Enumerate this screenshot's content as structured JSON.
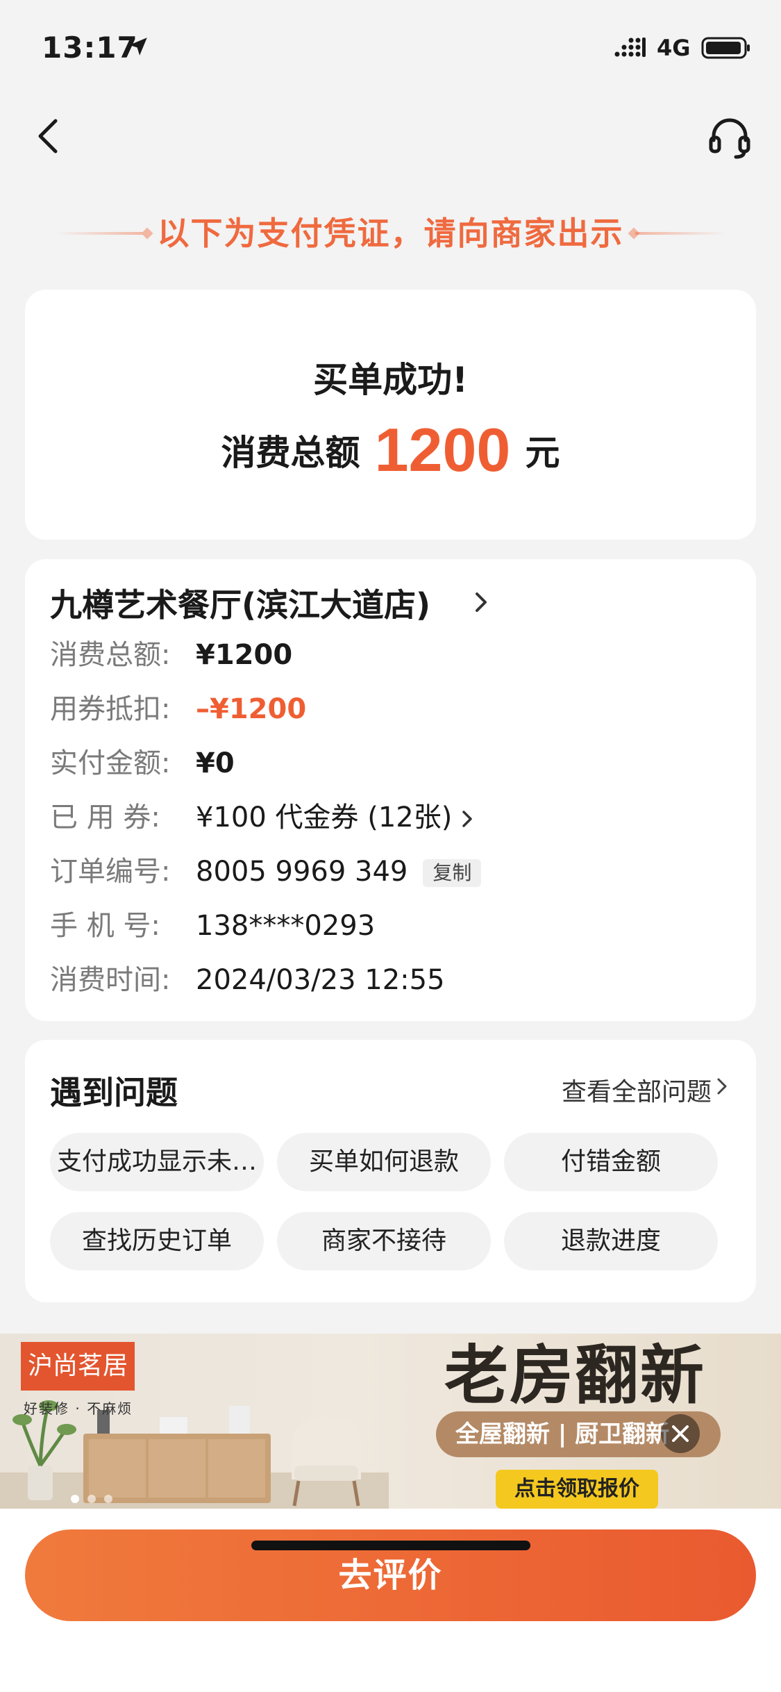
{
  "status_bar": {
    "time": "13:17",
    "network": "4G"
  },
  "header": {
    "voucher_text": "以下为支付凭证，请向商家出示"
  },
  "success": {
    "title": "买单成功!",
    "total_label": "消费总额",
    "total_amount": "1200",
    "total_unit": "元"
  },
  "order": {
    "store_name": "九樽艺术餐厅(滨江大道店)",
    "rows": [
      {
        "label": "消费总额:",
        "value": "¥1200"
      },
      {
        "label": "用券抵扣:",
        "value": "–¥1200"
      },
      {
        "label": "实付金额:",
        "value": "¥0"
      },
      {
        "label": "已 用 券:",
        "value": "¥100 代金券 (12张)"
      },
      {
        "label": "订单编号:",
        "value": "8005 9969 349",
        "copy_label": "复制"
      },
      {
        "label": "手 机 号:",
        "value": "138****0293"
      },
      {
        "label": "消费时间:",
        "value": "2024/03/23 12:55"
      }
    ]
  },
  "problems": {
    "title": "遇到问题",
    "view_all": "查看全部问题",
    "chips": [
      "支付成功显示未…",
      "买单如何退款",
      "付错金额",
      "查找历史订单",
      "商家不接待",
      "退款进度"
    ]
  },
  "ad": {
    "brand": "沪尚茗居",
    "slogan": "好装修 · 不麻烦",
    "headline": "老房翻新",
    "pill_text": "全屋翻新 | 厨卫翻新",
    "cta": "点击领取报价"
  },
  "bottom": {
    "review_label": "去评价"
  },
  "colors": {
    "accent": "#ef5e33",
    "background": "#f3f3f3"
  }
}
